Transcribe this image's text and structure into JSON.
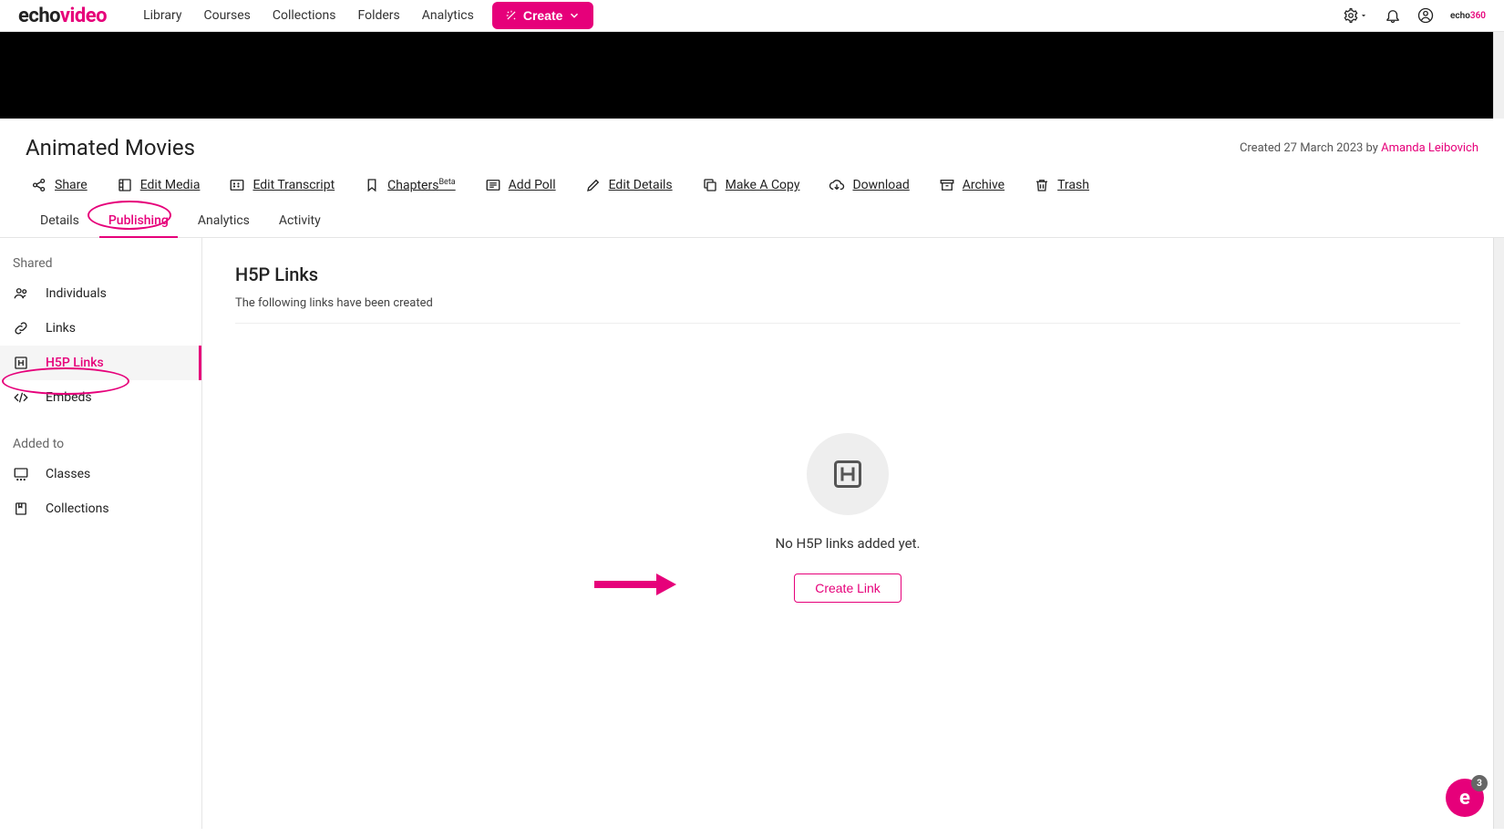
{
  "header": {
    "logo1": "echo",
    "logo2": "video",
    "nav": [
      "Library",
      "Courses",
      "Collections",
      "Folders",
      "Analytics"
    ],
    "create_label": "Create",
    "brand1": "echo",
    "brand2": "360"
  },
  "page": {
    "title": "Animated Movies",
    "created_prefix": "Created 27 March 2023 by ",
    "created_author": "Amanda Leibovich"
  },
  "actions": {
    "share": "Share",
    "edit_media": "Edit Media",
    "edit_transcript": "Edit Transcript",
    "chapters": "Chapters",
    "chapters_beta": "Beta",
    "add_poll": "Add Poll",
    "edit_details": "Edit Details",
    "make_copy": "Make A Copy",
    "download": "Download",
    "archive": "Archive",
    "trash": "Trash"
  },
  "subtabs": {
    "details": "Details",
    "publishing": "Publishing",
    "analytics": "Analytics",
    "activity": "Activity",
    "active": "publishing"
  },
  "sidebar": {
    "shared_head": "Shared",
    "individuals": "Individuals",
    "links": "Links",
    "h5p_links": "H5P Links",
    "embeds": "Embeds",
    "added_head": "Added to",
    "classes": "Classes",
    "collections": "Collections",
    "active": "h5p_links"
  },
  "main": {
    "heading": "H5P Links",
    "desc": "The following links have been created",
    "empty_msg": "No H5P links added yet.",
    "create_link_label": "Create Link"
  },
  "widget": {
    "letter": "e",
    "badge": "3"
  }
}
